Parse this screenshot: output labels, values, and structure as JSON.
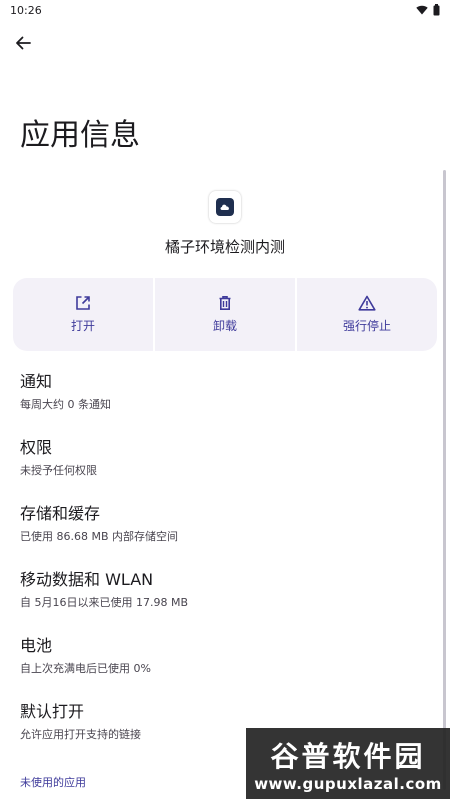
{
  "status_bar": {
    "time": "10:26"
  },
  "header": {
    "title": "应用信息"
  },
  "app": {
    "name": "橘子环境检测内测"
  },
  "actions": [
    {
      "label": "打开",
      "icon": "open-external-icon"
    },
    {
      "label": "卸载",
      "icon": "trash-icon"
    },
    {
      "label": "强行停止",
      "icon": "warning-icon"
    }
  ],
  "items": [
    {
      "title": "通知",
      "subtitle": "每周大约 0 条通知"
    },
    {
      "title": "权限",
      "subtitle": "未授予任何权限"
    },
    {
      "title": "存储和缓存",
      "subtitle": "已使用 86.68 MB 内部存储空间"
    },
    {
      "title": "移动数据和 WLAN",
      "subtitle": "自 5月16日以来已使用 17.98 MB"
    },
    {
      "title": "电池",
      "subtitle": "自上次充满电后已使用 0%"
    },
    {
      "title": "默认打开",
      "subtitle": "允许应用打开支持的链接"
    }
  ],
  "unused_apps_link": "未使用的应用",
  "watermark": {
    "text": "谷普软件园",
    "url": "www.gupuxlazal.com"
  },
  "colors": {
    "accent": "#3f3b9b",
    "action_bg": "#f3f1f8"
  }
}
